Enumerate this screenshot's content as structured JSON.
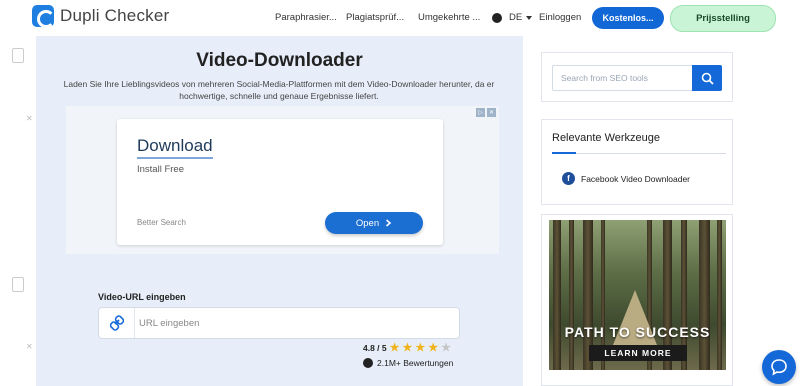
{
  "header": {
    "logo_text": "Dupli Checker",
    "nav": [
      {
        "label": "Paraphrasier..."
      },
      {
        "label": "Plagiatsprüf..."
      },
      {
        "label": "Umgekehrte ..."
      },
      {
        "label": "DE"
      }
    ],
    "login_label": "Einloggen",
    "free_label": "Kostenlos...",
    "pricing_label": "Prijsstelling"
  },
  "tool": {
    "title": "Video-Downloader",
    "description": "Laden Sie Ihre Lieblingsvideos von mehreren Social-Media-Plattformen mit dem Video-Downloader herunter, da er hochwertige, schnelle und genaue Ergebnisse liefert.",
    "url_label": "Video-URL eingeben",
    "url_placeholder": "URL eingeben",
    "url_value": "",
    "rating": "4.8 / 5",
    "rating_stars": 4.5,
    "reviews": "2.1M+ Bewertungen"
  },
  "ad": {
    "title": "Download",
    "subtitle": "Install Free",
    "source": "Better Search",
    "open_label": "Open"
  },
  "sidebar": {
    "search_placeholder": "Search from SEO tools",
    "tools_title": "Relevante Werkzeuge",
    "tools": [
      {
        "label": "Facebook Video Downloader",
        "icon": "facebook-icon"
      }
    ],
    "promo_title": "PATH TO SUCCESS",
    "promo_button": "LEARN MORE"
  },
  "colors": {
    "accent": "#1167d6",
    "pricing_bg": "#c9f5d6",
    "tool_bg": "#e7eef9"
  }
}
